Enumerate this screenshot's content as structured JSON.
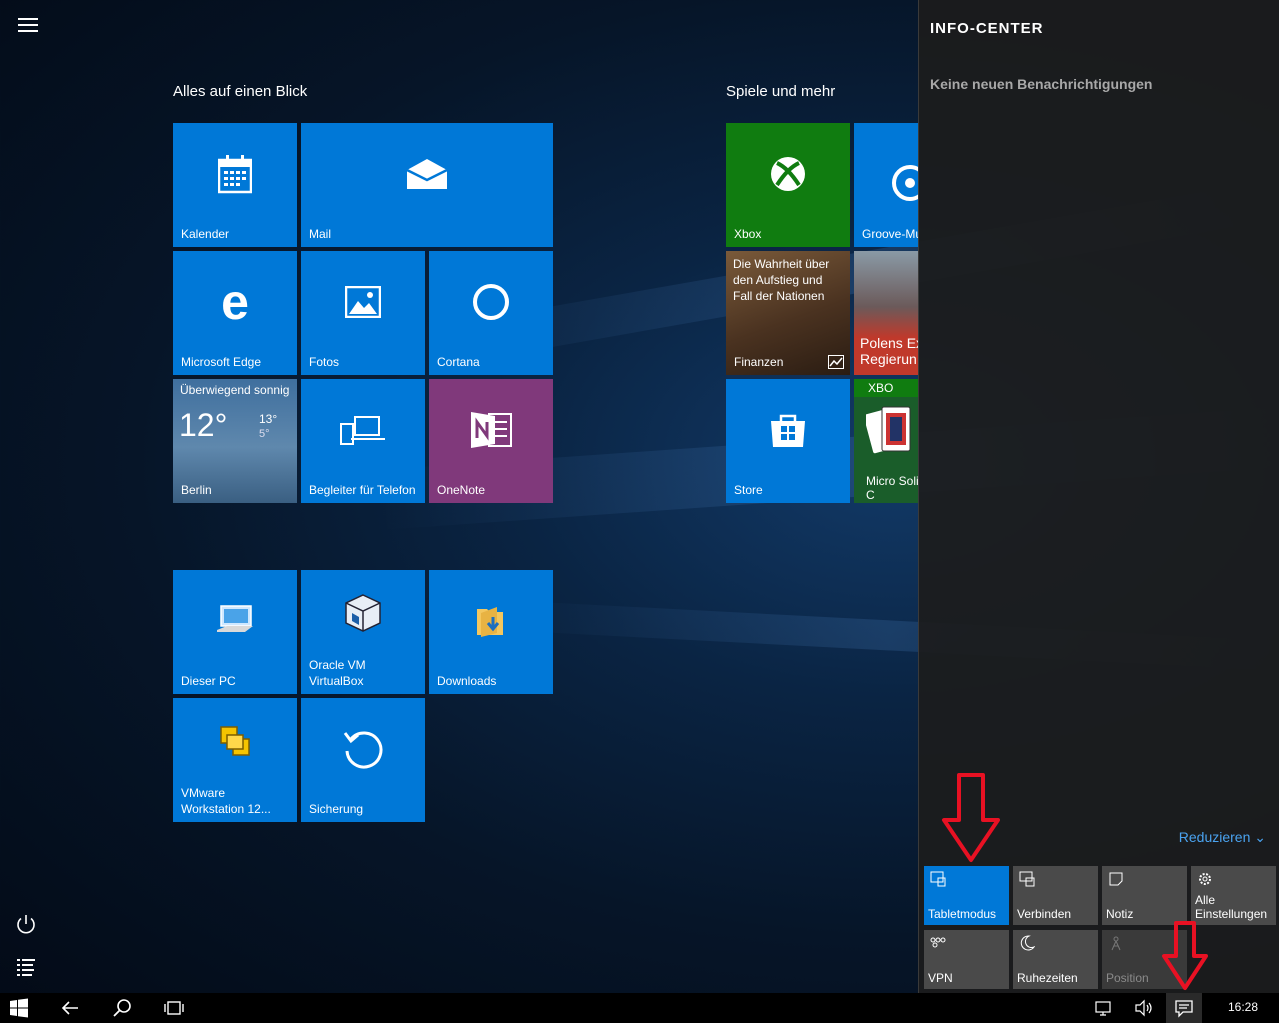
{
  "start": {
    "groups": [
      {
        "title": "Alles auf einen Blick"
      },
      {
        "title": "Spiele und mehr"
      }
    ],
    "tiles": {
      "kalender": "Kalender",
      "mail": "Mail",
      "edge": "Microsoft Edge",
      "fotos": "Fotos",
      "cortana": "Cortana",
      "weather_title": "Überwiegend sonnig",
      "weather_temp": "12°",
      "weather_high": "13°",
      "weather_low": "5°",
      "weather_city": "Berlin",
      "begleiter": "Begleiter für Telefon",
      "onenote": "OneNote",
      "xbox": "Xbox",
      "groove": "Groove-Mu",
      "finanzen_news": "Die Wahrheit über den Aufstieg und Fall der Nationen",
      "finanzen": "Finanzen",
      "news_headline": "Polens Ex Regierun",
      "store": "Store",
      "solitaire_badge": "XBO",
      "solitaire": "Micro Solitaire C",
      "dieser_pc": "Dieser PC",
      "virtualbox_1": "Oracle VM",
      "virtualbox_2": "VirtualBox",
      "downloads": "Downloads",
      "vmware_1": "VMware",
      "vmware_2": "Workstation 12...",
      "sicherung": "Sicherung"
    },
    "left_icons": [
      "hamburger-icon",
      "power-icon",
      "all-apps-icon"
    ]
  },
  "action_center": {
    "title": "INFO-CENTER",
    "empty_text": "Keine neuen Benachrichtigungen",
    "collapse_label": "Reduzieren",
    "quick_actions": [
      {
        "label": "Tabletmodus",
        "state": "on",
        "icon": "tablet-mode-icon"
      },
      {
        "label": "Verbinden",
        "state": "off",
        "icon": "connect-icon"
      },
      {
        "label": "Notiz",
        "state": "off",
        "icon": "note-icon"
      },
      {
        "label": "Alle Einstellungen",
        "state": "off",
        "icon": "settings-gear-icon"
      },
      {
        "label": "VPN",
        "state": "off",
        "icon": "vpn-icon"
      },
      {
        "label": "Ruhezeiten",
        "state": "off",
        "icon": "moon-icon"
      },
      {
        "label": "Position",
        "state": "disabled",
        "icon": "location-icon"
      }
    ]
  },
  "taskbar": {
    "clock": "16:28",
    "icons": [
      "windows-start-icon",
      "back-arrow-icon",
      "search-icon",
      "task-view-icon",
      "network-icon",
      "volume-icon",
      "action-center-icon"
    ]
  },
  "colors": {
    "accent": "#0078d7",
    "xbox": "#107c10",
    "onenote": "#80397b",
    "annotation_arrow": "#e81123"
  }
}
